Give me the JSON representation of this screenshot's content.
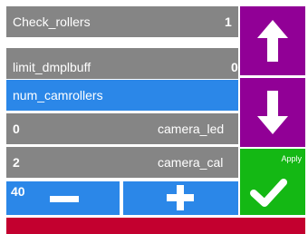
{
  "list": {
    "rows": [
      {
        "label": "Check_rollers",
        "value": "1",
        "extra": ""
      },
      {
        "label": "limit_dmplbuff",
        "value": "0",
        "extra": ""
      },
      {
        "label": "num_camrollers",
        "value": "",
        "extra": ""
      },
      {
        "label": "0",
        "value": "",
        "extra": "camera_led"
      },
      {
        "label": "2",
        "value": "",
        "extra": "camera_cal"
      }
    ],
    "selected_index": 2
  },
  "stepper": {
    "value": "40"
  },
  "actions": {
    "apply_label": "Apply"
  },
  "icons": {
    "up": "arrow-up-icon",
    "down": "arrow-down-icon",
    "apply": "checkmark-icon",
    "decrement": "minus-icon",
    "increment": "plus-icon"
  },
  "status": {
    "text": ""
  },
  "colors": {
    "row": "#858585",
    "selected": "#2b87e8",
    "nav": "#910096",
    "apply": "#14b814",
    "status_bar": "#c3002f"
  }
}
